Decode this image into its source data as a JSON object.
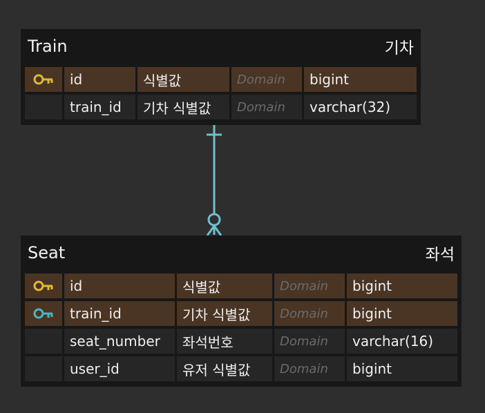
{
  "colors": {
    "background": "#2e2e2e",
    "table_bg": "#171717",
    "pk_row_bg": "#4a3525",
    "row_bg": "#262626",
    "primary_key_icon": "#e0b934",
    "foreign_key_icon": "#4ab5c2",
    "relation_line": "#6fc0cc"
  },
  "tables": [
    {
      "name": "Train",
      "logical_name": "기차",
      "columns": [
        {
          "key": "primary-key-icon",
          "name": "id",
          "logical": "식별값",
          "domain": "Domain",
          "type": "bigint"
        },
        {
          "key": "",
          "name": "train_id",
          "logical": "기차 식별값",
          "domain": "Domain",
          "type": "varchar(32)"
        }
      ]
    },
    {
      "name": "Seat",
      "logical_name": "좌석",
      "columns": [
        {
          "key": "primary-key-icon",
          "name": "id",
          "logical": "식별값",
          "domain": "Domain",
          "type": "bigint"
        },
        {
          "key": "foreign-key-icon",
          "name": "train_id",
          "logical": "기차 식별값",
          "domain": "Domain",
          "type": "bigint"
        },
        {
          "key": "",
          "name": "seat_number",
          "logical": "좌석번호",
          "domain": "Domain",
          "type": "varchar(16)"
        },
        {
          "key": "",
          "name": "user_id",
          "logical": "유저 식별값",
          "domain": "Domain",
          "type": "bigint"
        }
      ]
    }
  ],
  "relationship": {
    "from": "Train",
    "to": "Seat",
    "from_cardinality": "one",
    "to_cardinality": "zero-or-many"
  }
}
